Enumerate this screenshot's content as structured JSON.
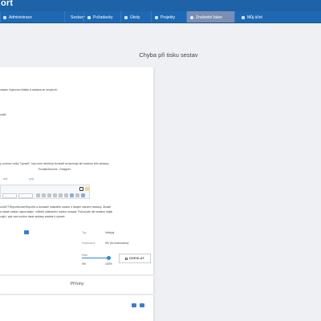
{
  "app": {
    "brand": "ort"
  },
  "nav": {
    "items": [
      {
        "label": "Administrace",
        "active": false
      },
      {
        "label": "Sestavy",
        "active": false
      },
      {
        "label": "Požadavky",
        "active": false
      },
      {
        "label": "Úkoly",
        "active": false
      },
      {
        "label": "Projekty",
        "active": false
      },
      {
        "label": "Znalostní báze",
        "active": true
      },
      {
        "label": "Můj účet",
        "active": false
      }
    ]
  },
  "page": {
    "title": "Chyba při tisku sestav"
  },
  "article": {
    "line1": "závám chybovou hlášku a sestava se nevytvoří.",
    "line2": "oraD:",
    "line3": "y, pomocí volby \"Upravit\", kdy nové otevřený formulář se jmenuje dle souboru této sestavy :",
    "line4": "PocitacSezonni - Designer",
    "editor_tab": "avit",
    "editor_tab2": "ýmy",
    "para1": "oortsTTReports\\UserReports\\ a dočasně odstraňte soubor s daným názvem sestavy. Zkuste",
    "para2": "a obsah sestav odpovídající. můžete odstranění soubor smazat. Pokud jste ale sestavu nějak",
    "para3": "vující, pak vám soubor dané sestavy zaslete k úpravě."
  },
  "meta": {
    "type_label": "Typ",
    "type_value": "Veřejný",
    "rating_label": "Hodnocení",
    "rating_value": "0% (0x hodnoceno)",
    "rate_label": "Rate",
    "rate_min": "0%",
    "rate_max": "100%",
    "rate_level": 1.0
  },
  "actions": {
    "send": "ODESLAT"
  },
  "attachments": {
    "title": "Přílohy"
  }
}
